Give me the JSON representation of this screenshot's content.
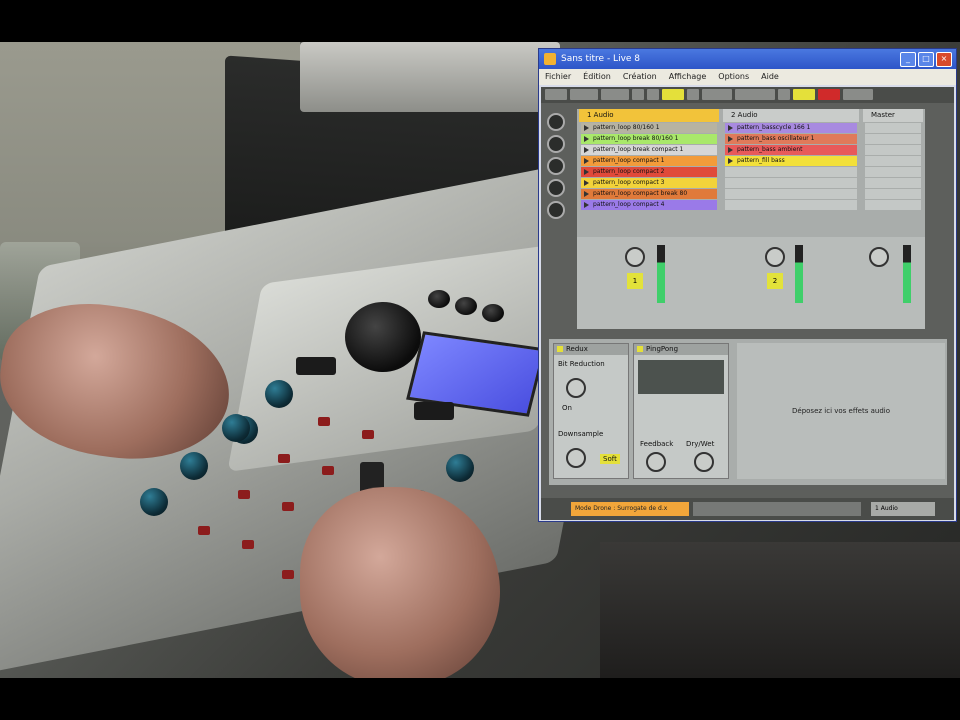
{
  "window": {
    "title": "Sans titre - Live 8",
    "menu": [
      "Fichier",
      "Édition",
      "Création",
      "Affichage",
      "Options",
      "Aide"
    ],
    "buttons": [
      "_",
      "□",
      "×"
    ]
  },
  "tracks": [
    {
      "name": "1 Audio",
      "header_color": "#f2c33a",
      "clips": [
        {
          "label": "pattern_loop 80/160 1",
          "color": "#b7b3a2"
        },
        {
          "label": "pattern_loop break 80/160 1",
          "color": "#a9e86a"
        },
        {
          "label": "pattern_loop break compact 1",
          "color": "#d6d6d6"
        },
        {
          "label": "pattern_loop compact 1",
          "color": "#f29b3a"
        },
        {
          "label": "pattern_loop compact 2",
          "color": "#e04a3a"
        },
        {
          "label": "pattern_loop compact 3",
          "color": "#f2d33a"
        },
        {
          "label": "pattern_loop compact break 80",
          "color": "#e07a3a"
        },
        {
          "label": "pattern_loop compact 4",
          "color": "#9a7ae8"
        }
      ],
      "number": "1"
    },
    {
      "name": "2 Audio",
      "header_color": "#c9ccca",
      "clips": [
        {
          "label": "pattern_basscycle 166 1",
          "color": "#a88ae0"
        },
        {
          "label": "pattern_bass oscillateur 1",
          "color": "#e07a5a"
        },
        {
          "label": "pattern_bass ambient",
          "color": "#e85a5a"
        },
        {
          "label": "pattern_fill bass",
          "color": "#f2e03a"
        }
      ],
      "number": "2"
    },
    {
      "name": "Master",
      "header_color": "#c9ccca",
      "clips": [],
      "number": ""
    }
  ],
  "devices": [
    {
      "title": "Redux",
      "labels": [
        "Bit Reduction",
        "Downsample"
      ],
      "toggle": "On",
      "mode": "Soft"
    },
    {
      "title": "PingPong",
      "labels": [
        "Feedback",
        "Dry/Wet"
      ]
    }
  ],
  "drop_hint": "Déposez ici vos effets audio",
  "status": {
    "message": "Mode Drone : Surrogate de d.x",
    "cpu": "1 Audio"
  }
}
